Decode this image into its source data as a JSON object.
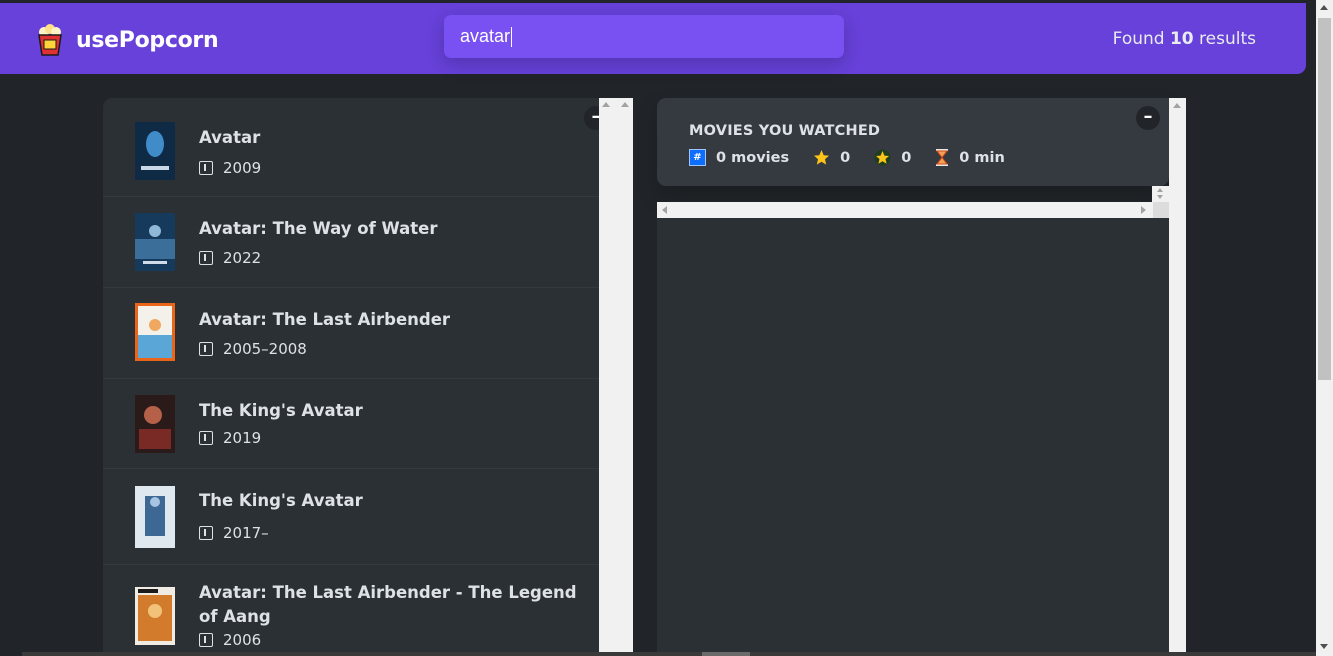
{
  "app": {
    "name": "usePopcorn"
  },
  "search": {
    "value": "avatar"
  },
  "results": {
    "prefix": "Found",
    "count": "10",
    "suffix": "results"
  },
  "movies": [
    {
      "title": "Avatar",
      "year": "2009",
      "poster_color": "#1f4f7a"
    },
    {
      "title": "Avatar: The Way of Water",
      "year": "2022",
      "poster_color": "#2c5d8a"
    },
    {
      "title": "Avatar: The Last Airbender",
      "year": "2005–2008",
      "poster_color": "#e06a1c"
    },
    {
      "title": "The King's Avatar",
      "year": "2019",
      "poster_color": "#8a3a2c"
    },
    {
      "title": "The King's Avatar",
      "year": "2017–",
      "poster_color": "#5f7fa8"
    },
    {
      "title": "Avatar: The Last Airbender - The Legend of Aang",
      "year": "2006",
      "poster_color": "#c9712e"
    }
  ],
  "summary": {
    "title": "MOVIES YOU WATCHED",
    "movies_count": "0 movies",
    "imdb_rating": "0",
    "user_rating": "0",
    "runtime": "0 min"
  },
  "toggle_label": "–",
  "colors": {
    "primary": "#6741d9",
    "primary_light": "#7950f2",
    "background": "#212529",
    "box": "#2b3035"
  }
}
